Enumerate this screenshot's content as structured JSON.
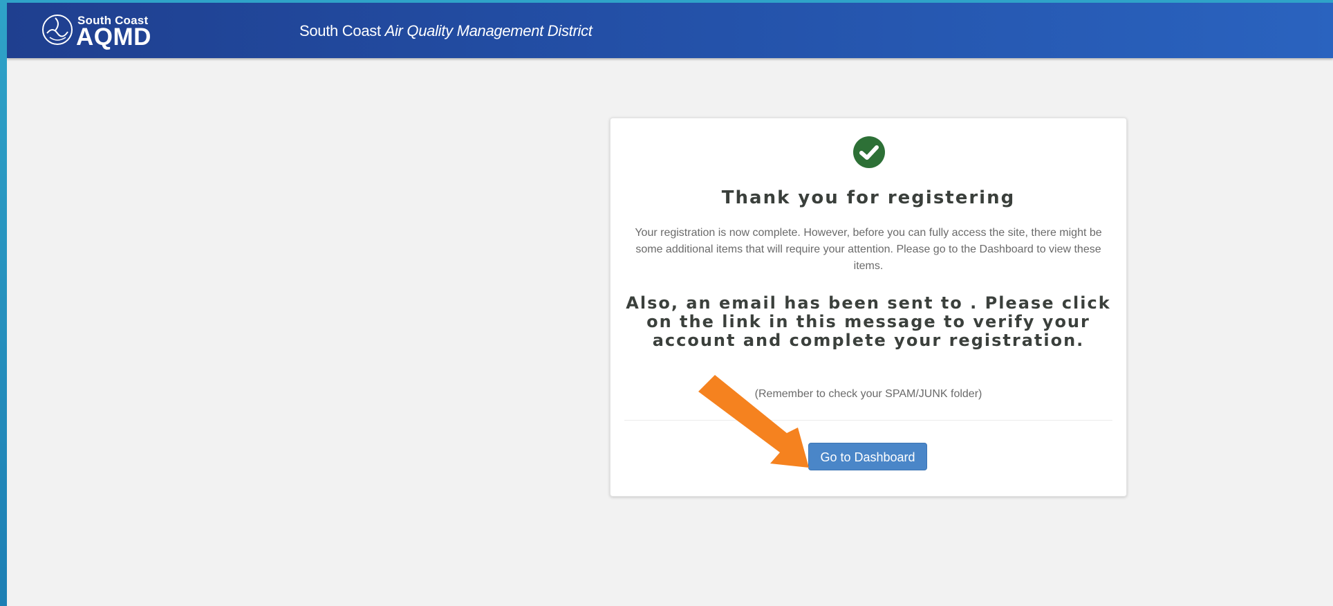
{
  "header": {
    "logo_small": "South Coast",
    "logo_big": "AQMD",
    "title_plain": "South Coast ",
    "title_italic": "Air Quality Management District"
  },
  "card": {
    "icon": "check-circle-icon",
    "heading": "Thank you for registering",
    "paragraph": "Your registration is now complete. However, before you can fully access the site, there might be some additional items that will require your attention. Please go to the Dashboard to view these items.",
    "email_notice": "Also, an email has been sent to . Please click on the link in this message to verify your account and complete your registration.",
    "spam_note": "(Remember to check your SPAM/JUNK folder)",
    "dashboard_button": "Go to Dashboard"
  },
  "colors": {
    "header_blue": "#234fa6",
    "check_green": "#2d7036",
    "button_blue": "#4a86c8",
    "arrow_orange": "#f5821f",
    "page_bg": "#f2f2f2"
  },
  "annotation": {
    "icon": "orange-pointer-arrow"
  }
}
